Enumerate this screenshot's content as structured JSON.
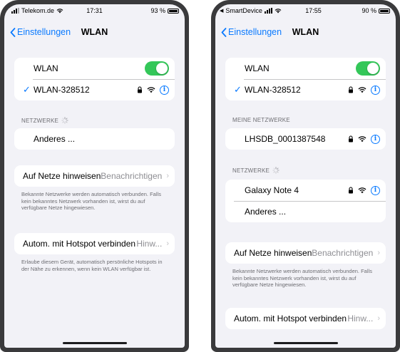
{
  "colors": {
    "accent": "#0a7aff",
    "toggle_on": "#34c759",
    "background": "#f2f2f7"
  },
  "left": {
    "status": {
      "carrier": "Telekom.de",
      "time": "17:31",
      "battery": "93 %",
      "battery_level": 0.93
    },
    "nav": {
      "back_label": "Einstellungen",
      "title": "WLAN"
    },
    "wlan": {
      "label": "WLAN",
      "toggle_on": true,
      "connected_network": "WLAN-328512"
    },
    "networks_header": "NETZWERKE",
    "other_label": "Anderes ...",
    "notify": {
      "label": "Auf Netze hinweisen",
      "value": "Benachrichtigen"
    },
    "notify_footer": "Bekannte Netzwerke werden automatisch verbunden. Falls kein bekanntes Netzwerk vorhanden ist, wirst du auf verfügbare Netze hingewiesen.",
    "hotspot": {
      "label": "Autom. mit Hotspot verbinden",
      "value": "Hinw..."
    },
    "hotspot_footer": "Erlaube diesem Gerät, automatisch persönliche Hotspots in der Nähe zu erkennen, wenn kein WLAN verfügbar ist."
  },
  "right": {
    "status": {
      "carrier": "SmartDevice",
      "time": "17:55",
      "battery": "90 %",
      "battery_level": 0.9
    },
    "nav": {
      "back_label": "Einstellungen",
      "title": "WLAN"
    },
    "wlan": {
      "label": "WLAN",
      "toggle_on": true,
      "connected_network": "WLAN-328512"
    },
    "my_networks_header": "MEINE NETZWERKE",
    "my_networks": [
      "LHSDB_0001387548"
    ],
    "networks_header": "NETZWERKE",
    "networks": [
      "Galaxy Note 4"
    ],
    "other_label": "Anderes ...",
    "notify": {
      "label": "Auf Netze hinweisen",
      "value": "Benachrichtigen"
    },
    "notify_footer": "Bekannte Netzwerke werden automatisch verbunden. Falls kein bekanntes Netzwerk vorhanden ist, wirst du auf verfügbare Netze hingewiesen.",
    "hotspot": {
      "label": "Autom. mit Hotspot verbinden",
      "value": "Hinw..."
    }
  }
}
